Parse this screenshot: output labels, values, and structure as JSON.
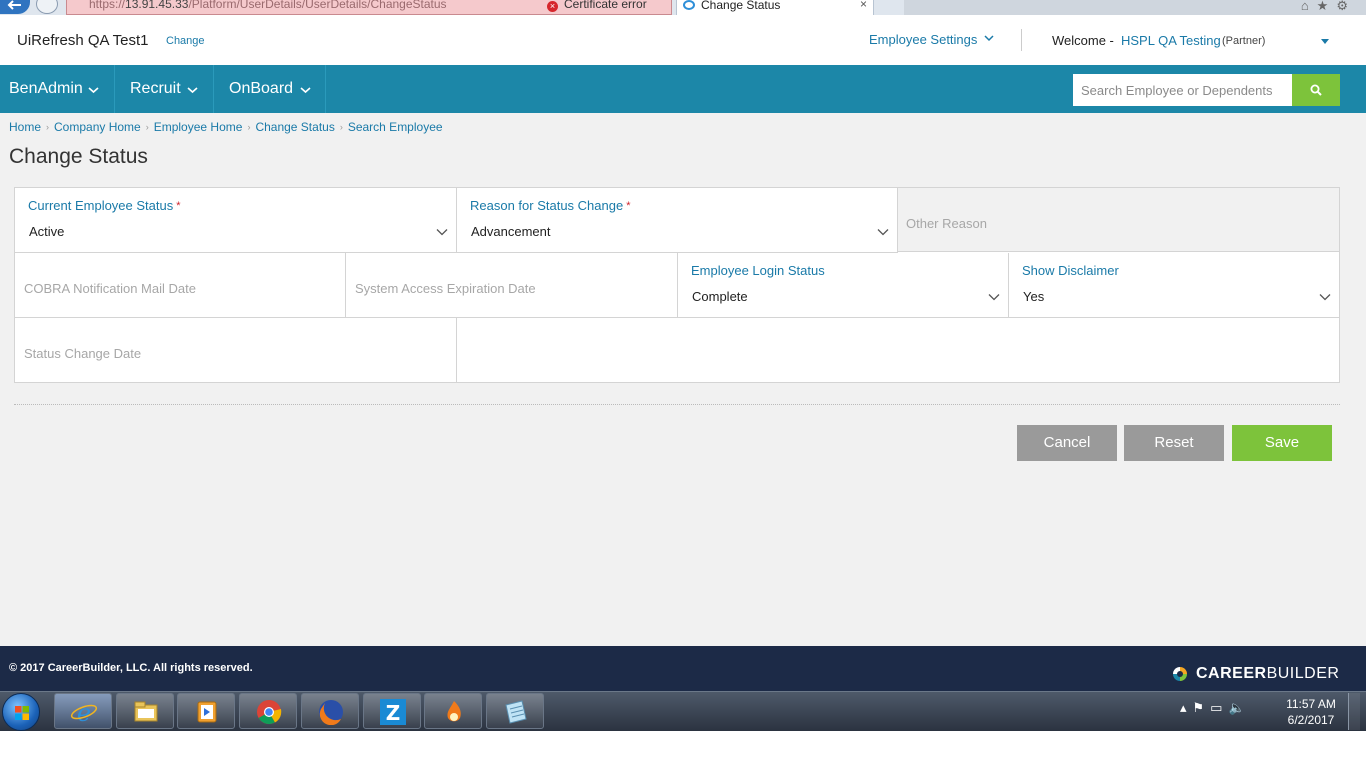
{
  "browser": {
    "url_prefix": "https://",
    "url_host": "13.91.45.33",
    "url_path": "/Platform/UserDetails/UserDetails/ChangeStatus",
    "cert_error": "Certificate error",
    "tab_title": "Change Status",
    "tab_close": "×"
  },
  "header": {
    "company": "UiRefresh QA Test1",
    "change_link": "Change",
    "employee_settings": "Employee Settings",
    "welcome_prefix": "Welcome -",
    "user_name": "HSPL QA Testing",
    "user_role": "(Partner)"
  },
  "nav": {
    "items": [
      {
        "label": "BenAdmin"
      },
      {
        "label": "Recruit"
      },
      {
        "label": "OnBoard"
      }
    ],
    "search_placeholder": "Search Employee or Dependents"
  },
  "breadcrumb": [
    "Home",
    "Company Home",
    "Employee Home",
    "Change Status",
    "Search Employee"
  ],
  "page_title": "Change Status",
  "form": {
    "current_status": {
      "label": "Current Employee Status",
      "required_mark": "*",
      "value": "Active"
    },
    "reason": {
      "label": "Reason for Status Change",
      "required_mark": "*",
      "value": "Advancement"
    },
    "other_reason": {
      "placeholder": "Other Reason"
    },
    "cobra_date": {
      "placeholder": "COBRA Notification Mail Date"
    },
    "system_access": {
      "placeholder": "System Access Expiration Date"
    },
    "login_status": {
      "label": "Employee Login Status",
      "value": "Complete"
    },
    "show_disclaimer": {
      "label": "Show Disclaimer",
      "value": "Yes"
    },
    "status_change_date": {
      "placeholder": "Status Change Date"
    }
  },
  "buttons": {
    "cancel": "Cancel",
    "reset": "Reset",
    "save": "Save"
  },
  "footer": {
    "copyright": "© 2017 CareerBuilder, LLC. All rights reserved.",
    "logo_career": "CAREER",
    "logo_builder": "BUILDER"
  },
  "taskbar": {
    "time": "11:57 AM",
    "date": "6/2/2017",
    "apps": [
      "internet-explorer",
      "file-explorer",
      "media-player",
      "chrome",
      "firefox",
      "zoom-z",
      "flame-app",
      "notepad"
    ]
  },
  "colors": {
    "nav_bg": "#1c87a8",
    "link": "#1a7aa8",
    "accent_green": "#7dc33b",
    "footer_bg": "#1c2a47",
    "button_gray": "#9a9a9a"
  }
}
